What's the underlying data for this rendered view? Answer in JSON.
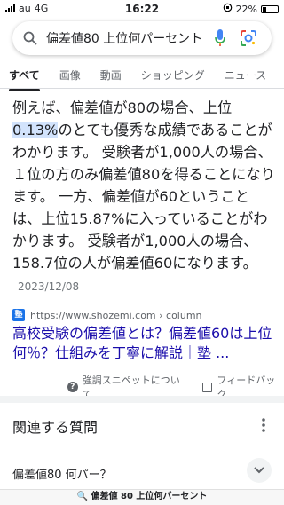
{
  "status_bar": {
    "carrier": "au",
    "network": "4G",
    "time": "16:22",
    "battery": "22%",
    "battery_level": 0.22
  },
  "search": {
    "query": "偏差値80 上位何パーセント",
    "icons": [
      "search-icon",
      "mic-icon",
      "google-lens-icon"
    ]
  },
  "tabs": [
    {
      "label": "すべて",
      "active": true
    },
    {
      "label": "画像"
    },
    {
      "label": "動画"
    },
    {
      "label": "ショッピング"
    },
    {
      "label": "ニュース"
    }
  ],
  "snippet": {
    "before": "例えば、偏差値が80の場合、上位",
    "highlight": "0.13%",
    "after": "のとても優秀な成績であることがわかります。 受験者が1,000人の場合、１位の方のみ偏差値80を得ることになります。 一方、偏差値が60ということは、上位15.87%に入っていることがわかります。 受験者が1,000人の場合、158.7位の人が偏差値60になります。",
    "date": "2023/12/08"
  },
  "source": {
    "favicon_text": "塾",
    "url": "https://www.shozemi.com › column"
  },
  "result_title": "高校受験の偏差値とは？偏差値60は上位何％？仕組みを丁寧に解説｜塾 ...",
  "feedback": {
    "about_label": "強調スニペットについて",
    "feedback_label": "フィードバック"
  },
  "related": {
    "title": "関連する質問",
    "question": "偏差値80 何パー？"
  },
  "bottom_bar": {
    "text": "偏差値 80 上位何パーセント"
  },
  "colors": {
    "link": "#1a0dab",
    "highlight": "#d2e3fc",
    "accent_blue": "#1a73e8"
  }
}
